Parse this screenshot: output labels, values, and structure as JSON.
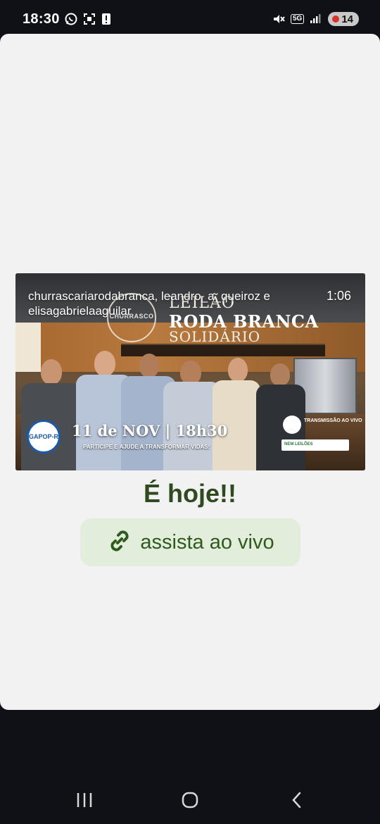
{
  "status_bar": {
    "time": "18:30",
    "network": "5G",
    "battery": "14",
    "left_icons": [
      "whatsapp-icon",
      "screenshot-icon",
      "alert-icon"
    ],
    "right_icons": [
      "mute-icon",
      "network-5g-icon",
      "signal-icon",
      "battery-icon"
    ]
  },
  "story": {
    "video": {
      "usernames": "churrascariarodabranca, leandro_a_queiroz e elisagabrielaaguilar",
      "duration": "1:06",
      "emblem_text": "CHURRASCO",
      "title_line1": "LEILÃO",
      "title_line2": "RODA BRANCA",
      "title_line3": "SOLIDÁRIO",
      "badge": "GAPOP-R",
      "date": "11 de NOV | 18h30",
      "tagline": "PARTICIPE E AJUDE A TRANSFORMAR VIDAS!",
      "transmission": "TRANSMISSÃO AO VIVO",
      "sponsors": "NEM  LEILÕES"
    },
    "heading": "É hoje!!",
    "link_label": "assista ao vivo",
    "colors": {
      "heading": "#2f4a1e",
      "link_bg": "#e2eedb",
      "link_text": "#2f5a1e"
    }
  },
  "nav": {
    "icons": [
      "recents-icon",
      "home-icon",
      "back-icon"
    ]
  }
}
